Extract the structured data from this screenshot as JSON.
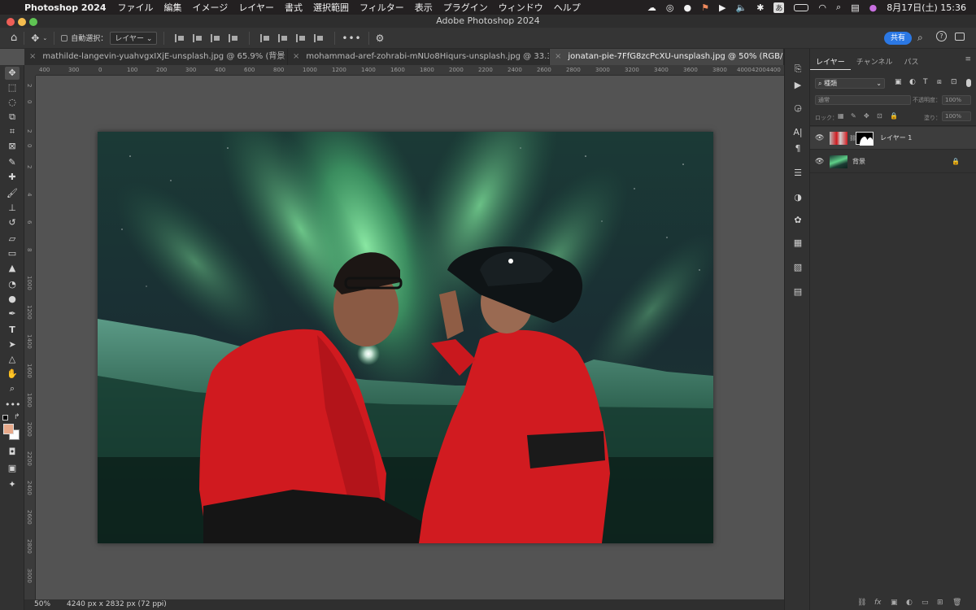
{
  "menubar": {
    "app_name": "Photoshop 2024",
    "items": [
      "ファイル",
      "編集",
      "イメージ",
      "レイヤー",
      "書式",
      "選択範囲",
      "フィルター",
      "表示",
      "プラグイン",
      "ウィンドウ",
      "ヘルプ"
    ],
    "input_mode": "あ",
    "date_time": "8月17日(土)  15:36"
  },
  "titlebar": {
    "title": "Adobe Photoshop 2024"
  },
  "options": {
    "auto_select_label": "自動選択：",
    "auto_select_target": "レイヤー",
    "share_label": "共有"
  },
  "tabs": [
    {
      "label": "mathilde-langevin-yuahvgxIXjE-unsplash.jpg @ 65.9% (背景 のコピー, ...",
      "active": false
    },
    {
      "label": "mohammad-aref-zohrabi-mNUo8Hiqurs-unsplash.jpg @ 33.3% (レイ...",
      "active": false
    },
    {
      "label": "jonatan-pie-7FfG8zcPcXU-unsplash.jpg @ 50% (RGB/8) *",
      "active": true
    }
  ],
  "ruler_top": [
    "400",
    "300",
    "0",
    "100",
    "200",
    "300",
    "400",
    "600",
    "800",
    "1000",
    "1200",
    "1400",
    "1600",
    "1800",
    "2000",
    "2200",
    "2400",
    "2600",
    "2800",
    "3000",
    "3200",
    "3400",
    "3600",
    "3800",
    "4000",
    "4200",
    "4400"
  ],
  "ruler_left": [
    "2",
    "0",
    "2",
    "0",
    "2",
    "4",
    "6",
    "8",
    "1000",
    "1200",
    "1400",
    "1600",
    "1800",
    "2000",
    "2200",
    "2400",
    "2600",
    "2800",
    "3000"
  ],
  "status": {
    "zoom": "50%",
    "doc_size": "4240 px x 2832 px (72 ppi)"
  },
  "layers_panel": {
    "tabs": [
      "レイヤー",
      "チャンネル",
      "パス"
    ],
    "filter_label": "種類",
    "blend_mode": "通常",
    "opacity_label": "不透明度：",
    "opacity_value": "100%",
    "lock_label": "ロック：",
    "fill_label": "塗り：",
    "fill_value": "100%",
    "layers": [
      {
        "name": "レイヤー 1",
        "visible": true,
        "has_mask": true
      },
      {
        "name": "背景",
        "visible": true,
        "locked": true
      }
    ],
    "footer_icons": [
      "link-icon",
      "fx-icon",
      "mask-icon",
      "adjustment-icon",
      "group-icon",
      "new-layer-icon",
      "trash-icon"
    ]
  },
  "colors": {
    "foreground": "#e8a98a",
    "background": "#ffffff",
    "accent": "#2b78e4",
    "aurora": "#5fcf88",
    "sweater_red": "#d01a1f"
  }
}
